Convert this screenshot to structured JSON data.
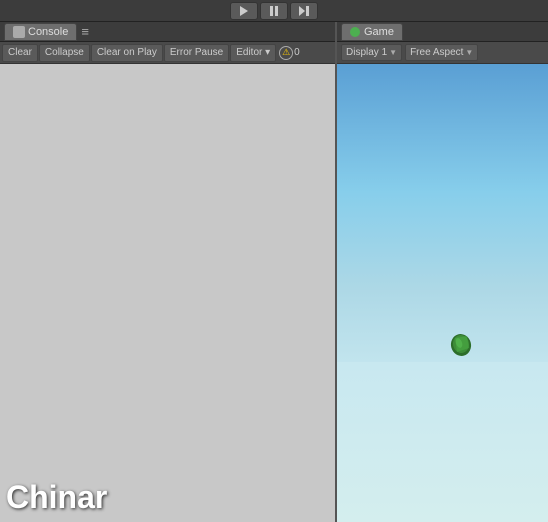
{
  "toolbar": {
    "play_label": "▶",
    "pause_label": "⏸",
    "step_label": "⏭"
  },
  "console": {
    "tab_label": "Console",
    "tab_icon": "console-icon",
    "menu_icon": "≡",
    "buttons": {
      "clear": "Clear",
      "collapse": "Collapse",
      "clear_on_play": "Clear on Play",
      "error_pause": "Error Pause",
      "editor": "Editor ▾"
    },
    "warning_icon": "⚠",
    "count": "0"
  },
  "game": {
    "tab_label": "Game",
    "tab_icon": "game-icon",
    "display_label": "Display 1",
    "aspect_label": "Free Aspect"
  },
  "footer": {
    "chinar_text": "Chinar"
  }
}
